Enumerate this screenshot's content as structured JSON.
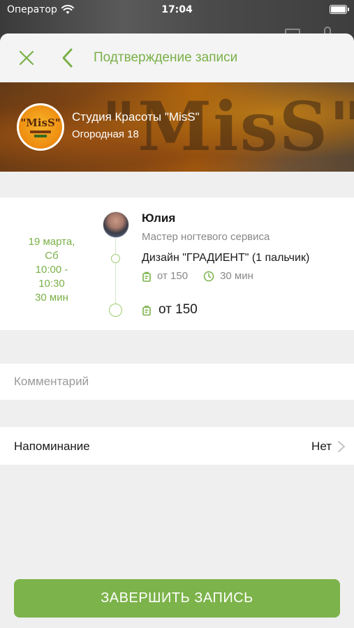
{
  "status_bar": {
    "carrier": "Оператор",
    "time": "17:04"
  },
  "nav": {
    "title": "Подтверждение записи"
  },
  "salon": {
    "name": "Студия Красоты \"MisS\"",
    "address": "Огородная 18",
    "logo_text": "\"MisS\"",
    "banner_watermark": "\"MisS\""
  },
  "booking": {
    "date_line1": "19 марта,",
    "date_line2": "Сб",
    "time_start": "10:00 -",
    "time_end": "10:30",
    "duration": "30 мин",
    "master": {
      "name": "Юлия",
      "role": "Мастер ногтевого сервиса"
    },
    "service": {
      "name": "Дизайн \"ГРАДИЕНТ\" (1 пальчик)",
      "price": "от 150",
      "duration": "30 мин"
    },
    "total_price": "от 150"
  },
  "comment": {
    "placeholder": "Комментарий",
    "value": ""
  },
  "reminder": {
    "label": "Напоминание",
    "value": "Нет"
  },
  "submit_label": "ЗАВЕРШИТЬ ЗАПИСЬ",
  "colors": {
    "accent": "#7cb34a",
    "background": "#efefef"
  }
}
